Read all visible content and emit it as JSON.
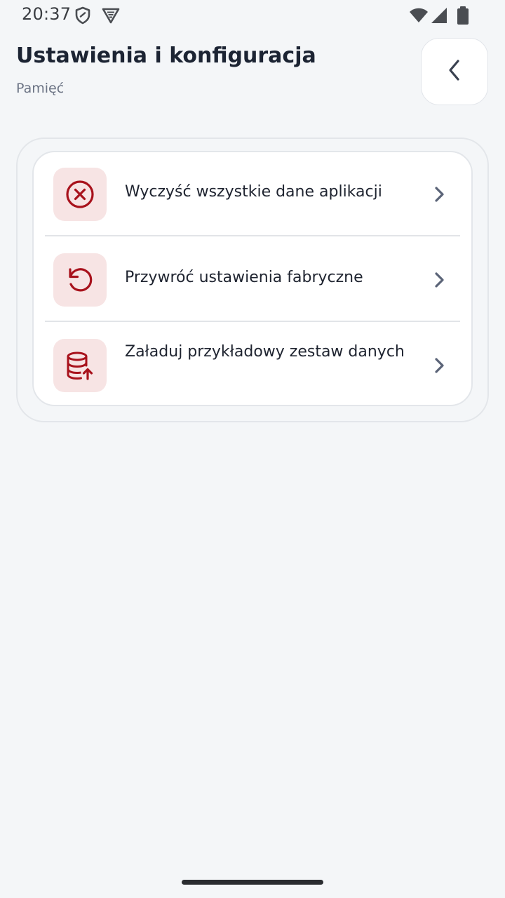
{
  "status_bar": {
    "time": "20:37",
    "icons": [
      "shield-icon",
      "vpn-badge-icon",
      "wifi-icon",
      "cellular-signal-icon",
      "battery-icon"
    ]
  },
  "header": {
    "title": "Ustawienia i konfiguracja",
    "subtitle": "Pamięć",
    "back_icon": "chevron-left-icon"
  },
  "settings": {
    "items": [
      {
        "label": "Wyczyść wszystkie dane aplikacji",
        "icon": "clear-circle-icon"
      },
      {
        "label": "Przywróć ustawienia fabryczne",
        "icon": "restore-icon"
      },
      {
        "label": "Załaduj przykładowy zestaw danych",
        "icon": "database-upload-icon"
      }
    ]
  },
  "colors": {
    "background": "#f4f6f8",
    "accent": "#a8121c",
    "icon_tile": "#f7e4e4",
    "chevron": "#5b6478"
  }
}
